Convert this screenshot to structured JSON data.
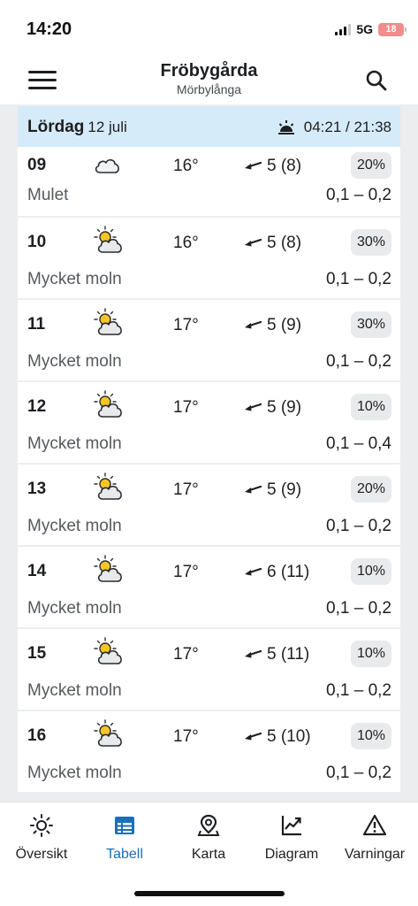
{
  "status": {
    "time": "14:20",
    "network": "5G",
    "battery": "18"
  },
  "header": {
    "title": "Fröbygårda",
    "subtitle": "Mörbylånga"
  },
  "day": {
    "name": "Lördag",
    "date": "12 juli",
    "sun": "04:21 / 21:38"
  },
  "rows": [
    {
      "hour": "09",
      "icon": "cloud-icon",
      "temp": "16°",
      "wind": "5 (8)",
      "prob": "20%",
      "cond": "Mulet",
      "precip": "0,1 – 0,2"
    },
    {
      "hour": "10",
      "icon": "partly-sunny-icon",
      "temp": "16°",
      "wind": "5 (8)",
      "prob": "30%",
      "cond": "Mycket moln",
      "precip": "0,1 – 0,2"
    },
    {
      "hour": "11",
      "icon": "partly-sunny-icon",
      "temp": "17°",
      "wind": "5 (9)",
      "prob": "30%",
      "cond": "Mycket moln",
      "precip": "0,1 – 0,2"
    },
    {
      "hour": "12",
      "icon": "partly-sunny-icon",
      "temp": "17°",
      "wind": "5 (9)",
      "prob": "10%",
      "cond": "Mycket moln",
      "precip": "0,1 – 0,4"
    },
    {
      "hour": "13",
      "icon": "partly-sunny-icon",
      "temp": "17°",
      "wind": "5 (9)",
      "prob": "20%",
      "cond": "Mycket moln",
      "precip": "0,1 – 0,2"
    },
    {
      "hour": "14",
      "icon": "partly-sunny-icon",
      "temp": "17°",
      "wind": "6 (11)",
      "prob": "10%",
      "cond": "Mycket moln",
      "precip": "0,1 – 0,2"
    },
    {
      "hour": "15",
      "icon": "partly-sunny-icon",
      "temp": "17°",
      "wind": "5 (11)",
      "prob": "10%",
      "cond": "Mycket moln",
      "precip": "0,1 – 0,2"
    },
    {
      "hour": "16",
      "icon": "partly-sunny-icon",
      "temp": "17°",
      "wind": "5 (10)",
      "prob": "10%",
      "cond": "Mycket moln",
      "precip": "0,1 – 0,2"
    }
  ],
  "tabs": [
    {
      "label": "Översikt",
      "icon": "sun-icon"
    },
    {
      "label": "Tabell",
      "icon": "table-icon"
    },
    {
      "label": "Karta",
      "icon": "map-pin-icon"
    },
    {
      "label": "Diagram",
      "icon": "chart-icon"
    },
    {
      "label": "Varningar",
      "icon": "warning-icon"
    }
  ],
  "colors": {
    "accent": "#1a6fb8",
    "day_header_bg": "#d5ebfa",
    "battery": "#ef8c8c"
  }
}
